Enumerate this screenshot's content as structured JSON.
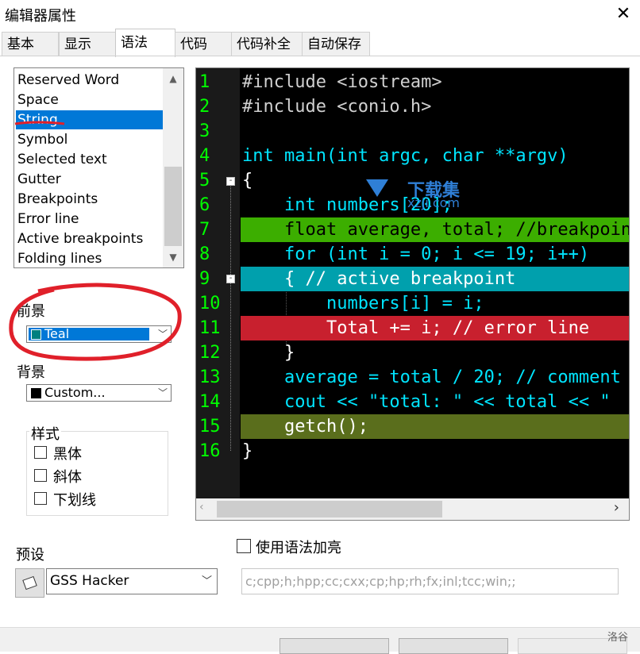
{
  "window": {
    "title": "编辑器属性",
    "close_icon": "close-icon"
  },
  "tabs": [
    {
      "label": "基本"
    },
    {
      "label": "显示"
    },
    {
      "label": "语法"
    },
    {
      "label": "代码"
    },
    {
      "label": "代码补全"
    },
    {
      "label": "自动保存"
    }
  ],
  "element_list": {
    "items": [
      {
        "label": "Reserved Word"
      },
      {
        "label": "Space"
      },
      {
        "label": "String"
      },
      {
        "label": "Symbol"
      },
      {
        "label": "Selected text"
      },
      {
        "label": "Gutter"
      },
      {
        "label": "Breakpoints"
      },
      {
        "label": "Error line"
      },
      {
        "label": "Active breakpoints"
      },
      {
        "label": "Folding lines"
      }
    ],
    "selected": "String"
  },
  "foreground": {
    "label": "前景",
    "value": "Teal",
    "swatch_color": "#008080"
  },
  "background": {
    "label": "背景",
    "value": "Custom...",
    "swatch_color": "#000000"
  },
  "style": {
    "label": "样式",
    "bold": "黑体",
    "italic": "斜体",
    "underline": "下划线"
  },
  "editor": {
    "line_numbers": [
      "1",
      "2",
      "3",
      "4",
      "5",
      "6",
      "7",
      "8",
      "9",
      "10",
      "11",
      "12",
      "13",
      "14",
      "15",
      "16"
    ],
    "lines": [
      "#include <iostream>",
      "#include <conio.h>",
      "",
      "int main(int argc, char **argv)",
      "{",
      "    int numbers[20];",
      "    float average, total; //breakpoint",
      "    for (int i = 0; i <= 19; i++)",
      "    { // active breakpoint",
      "        numbers[i] = i;",
      "        Total += i; // error line",
      "    }",
      "    average = total / 20; // comment",
      "    cout << \"total: \" << total << \"",
      "    getch();",
      "}"
    ],
    "highlight_colors": {
      "breakpoint": "#3cae00",
      "active_breakpoint": "#00a0ad",
      "error_line": "#c8202e",
      "selected": "#5a6e1c"
    }
  },
  "watermark": {
    "text": "下载集",
    "subtext": "xzji.com"
  },
  "syntax_highlight": {
    "label": "使用语法加亮",
    "checked": false
  },
  "preset": {
    "label": "预设",
    "value": "GSS Hacker"
  },
  "extensions": "c;cpp;h;hpp;cc;cxx;cp;hp;rh;fx;inl;tcc;win;;",
  "corner_text": "洛谷"
}
